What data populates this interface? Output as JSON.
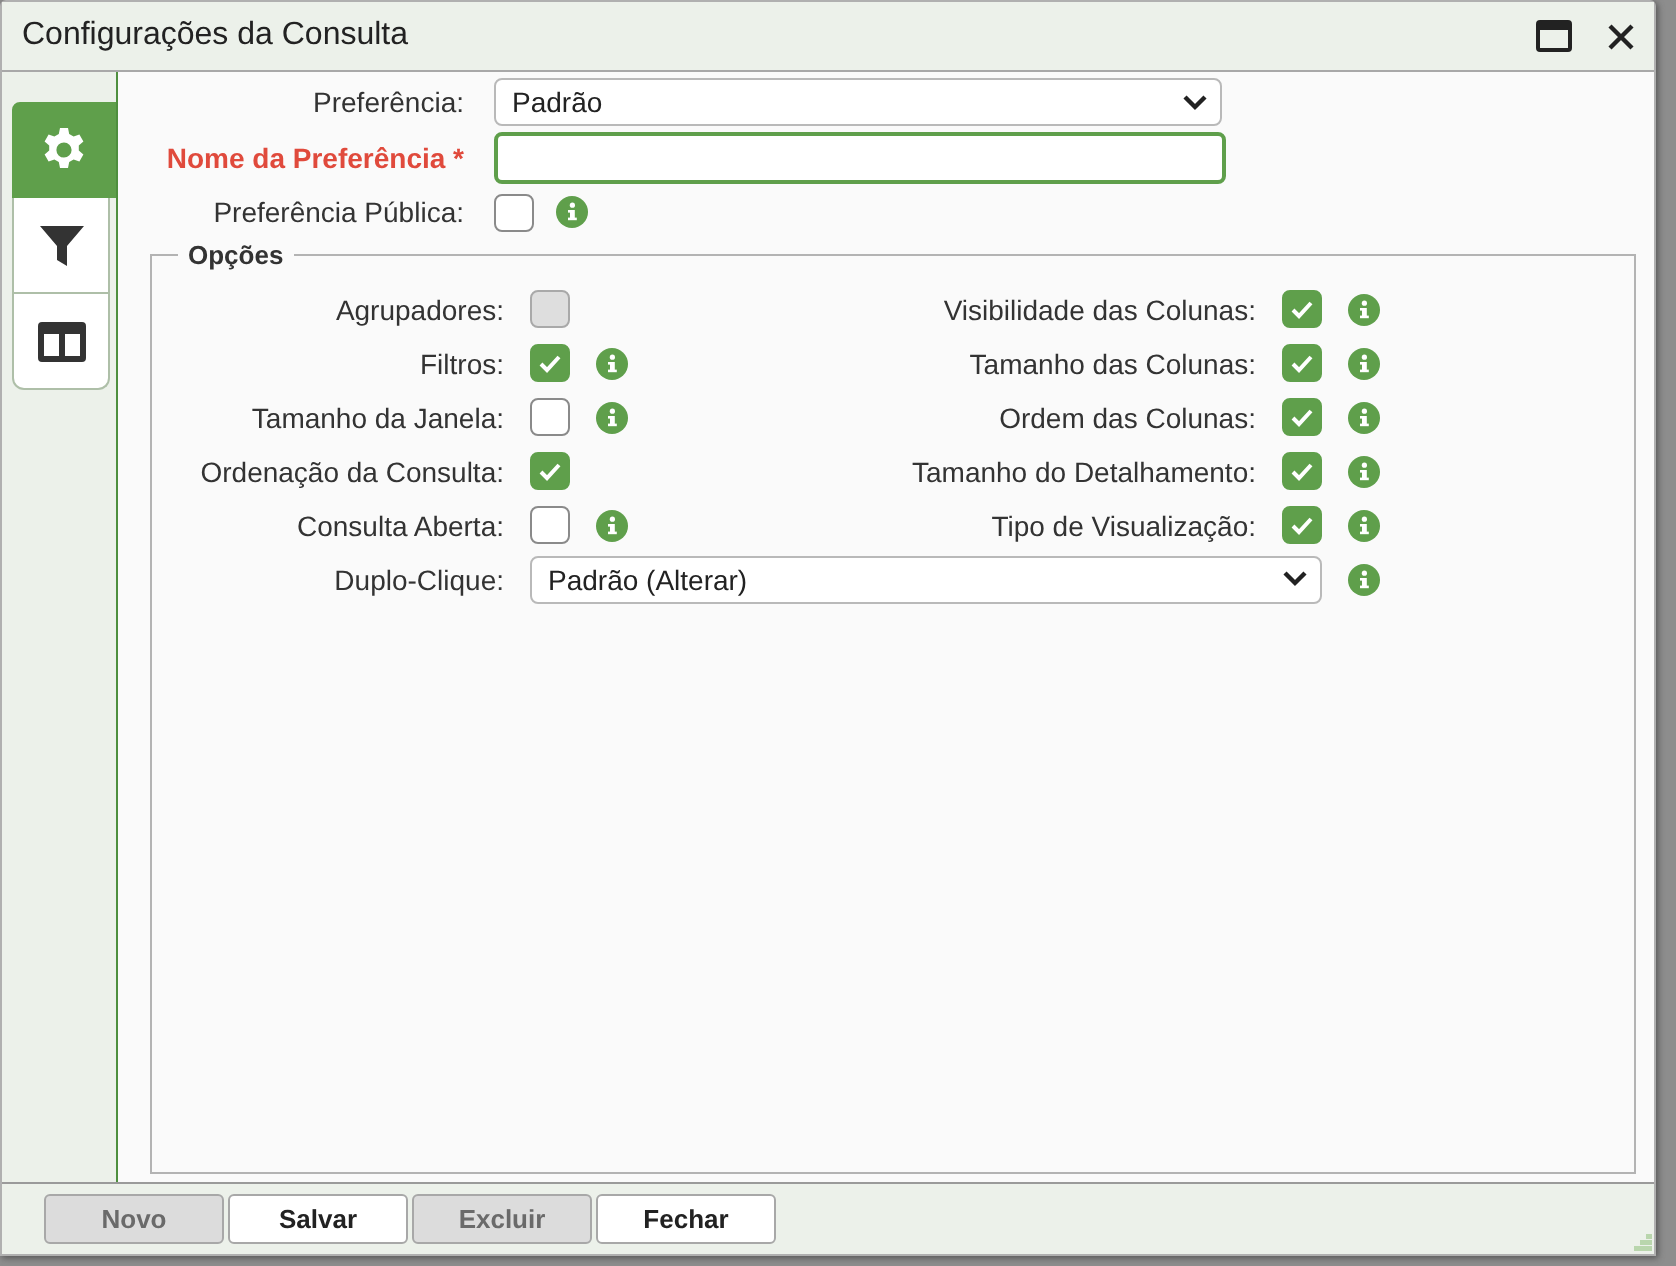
{
  "window": {
    "title": "Configurações da Consulta"
  },
  "sidebar": {
    "tabs": [
      {
        "kind": "settings",
        "selected": true
      },
      {
        "kind": "filter",
        "selected": false
      },
      {
        "kind": "layout",
        "selected": false
      }
    ]
  },
  "form": {
    "preference": {
      "label": "Preferência:",
      "value": "Padrão"
    },
    "name": {
      "label": "Nome da Preferência *",
      "required": true,
      "focused": true
    },
    "public": {
      "label": "Preferência Pública:",
      "checked": false,
      "info": true
    }
  },
  "options": {
    "legend": "Opções",
    "rows": [
      {
        "left": {
          "label": "Agrupadores:",
          "checked": false,
          "disabled": true,
          "info": false
        },
        "right": {
          "label": "Visibilidade das Colunas:",
          "checked": true,
          "disabled": false,
          "info": true
        }
      },
      {
        "left": {
          "label": "Filtros:",
          "checked": true,
          "disabled": false,
          "info": true
        },
        "right": {
          "label": "Tamanho das Colunas:",
          "checked": true,
          "disabled": false,
          "info": true
        }
      },
      {
        "left": {
          "label": "Tamanho da Janela:",
          "checked": false,
          "disabled": false,
          "info": true
        },
        "right": {
          "label": "Ordem das Colunas:",
          "checked": true,
          "disabled": false,
          "info": true
        }
      },
      {
        "left": {
          "label": "Ordenação da Consulta:",
          "checked": true,
          "disabled": false,
          "info": false
        },
        "right": {
          "label": "Tamanho do Detalhamento:",
          "checked": true,
          "disabled": false,
          "info": true
        }
      },
      {
        "left": {
          "label": "Consulta Aberta:",
          "checked": false,
          "disabled": false,
          "info": true
        },
        "right": {
          "label": "Tipo de Visualização:",
          "checked": true,
          "disabled": false,
          "info": true
        }
      }
    ],
    "double_click": {
      "label": "Duplo-Clique:",
      "value": "Padrão (Alterar)",
      "info": true
    }
  },
  "buttons": [
    {
      "label": "Novo",
      "disabled": true
    },
    {
      "label": "Salvar",
      "disabled": false
    },
    {
      "label": "Excluir",
      "disabled": true
    },
    {
      "label": "Fechar",
      "disabled": false
    }
  ]
}
